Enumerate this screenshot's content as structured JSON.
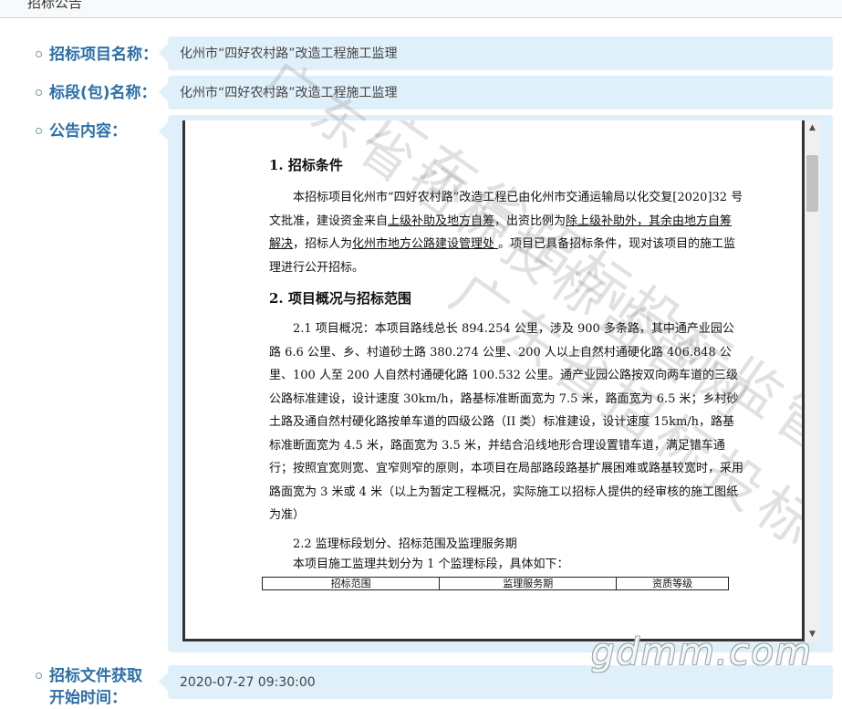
{
  "section": {
    "title": "招标公告"
  },
  "fields": [
    {
      "label": "招标项目名称：",
      "value": "化州市“四好农村路”改造工程施工监理"
    },
    {
      "label": "标段(包)名称：",
      "value": "化州市“四好农村路”改造工程施工监理"
    },
    {
      "label": "公告内容："
    },
    {
      "label_line1": "招标文件获取",
      "label_line2": "开始时间：",
      "value": "2020-07-27 09:30:00"
    }
  ],
  "document": {
    "h1": "1.  招标条件",
    "p1_a": "本招标项目化州市“四好农村路”改造工程已由化州市交通运输局以化交复[2020]32 号文批准，建设资金来自",
    "p1_u1": "上级补助及地方自筹",
    "p1_b": "，出资比例为",
    "p1_u2": "除上级补助外，其余由地方自筹解决",
    "p1_c": "，招标人为",
    "p1_u3": "化州市地方公路建设管理处 ",
    "p1_d": "。项目已具备招标条件，现对该项目的施工监理进行公开招标。",
    "h2": "2.  项目概况与招标范围",
    "p2": "2.1 项目概况：本项目路线总长 894.254 公里，涉及 900 多条路，其中通产业园公路 6.6 公里、乡、村道砂土路 380.274 公里、200 人以上自然村通硬化路 406.848 公里、100 人至 200 人自然村通硬化路 100.532 公里。通产业园公路按双向两车道的三级公路标准建设，设计速度 30km/h，路基标准断面宽为 7.5 米，路面宽为 6.5 米；乡村砂土路及通自然村硬化路按单车道的四级公路（II 类）标准建设，设计速度 15km/h，路基标准断面宽为 4.5 米，路面宽为 3.5 米，并结合沿线地形合理设置错车道，满足错车通行；按照宜宽则宽、宜窄则窄的原则，本项目在局部路段路基扩展困难或路基较宽时，采用路面宽为 3 米或 4 米（以上为暂定工程概况，实际施工以招标人提供的经审核的施工图纸为准）",
    "p3": "2.2 监理标段划分、招标范围及监理服务期",
    "p4": "本项目施工监理共划分为 1 个监理标段，具体如下：",
    "table_headers": [
      "招标范围",
      "监理服务期",
      "资质等级"
    ]
  },
  "scrollbar": {
    "up_icon": "▲",
    "down_icon": "▼",
    "position": 0.07
  },
  "watermarks": {
    "diagonal1": "广东省招标投标监管网",
    "diagonal2": "广东省招标投标监管网",
    "site": "gdmm.com"
  },
  "colors": {
    "label": "#2c6fa7",
    "value_bg": "#dff0fb"
  }
}
